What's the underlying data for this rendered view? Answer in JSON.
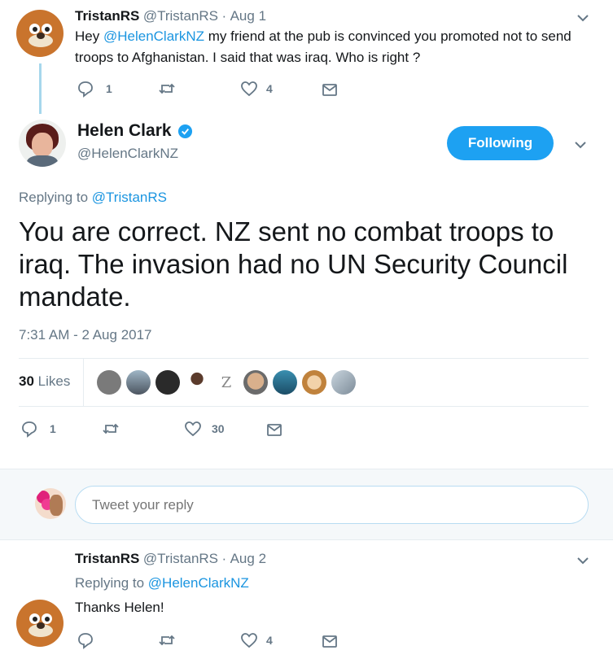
{
  "tweet1": {
    "author_name": "TristanRS",
    "author_handle": "@TristanRS",
    "separator": "·",
    "date": "Aug 1",
    "text_before": "Hey ",
    "mention": "@HelenClarkNZ",
    "text_after": " my friend at the pub is convinced you promoted not to send troops to Afghanistan. I said that was iraq. Who is right ?",
    "reply_count": "1",
    "retweet_count": "",
    "like_count": "4",
    "avatar_icon": "muppet-avatar-icon"
  },
  "main_tweet": {
    "author_name": "Helen Clark",
    "author_handle": "@HelenClarkNZ",
    "verified_icon": "verified-badge-icon",
    "follow_button_label": "Following",
    "replying_to_label": "Replying to ",
    "replying_to_handle": "@TristanRS",
    "text": "You are correct. NZ sent no combat troops to iraq. The invasion had no UN Security Council mandate.",
    "timestamp": "7:31 AM - 2 Aug 2017",
    "likes_count": "30",
    "likes_label": "Likes",
    "reply_count": "1",
    "retweet_count": "",
    "like_count": "30",
    "liker_avatar_count": 9,
    "liker_letter": "Z"
  },
  "reply_box": {
    "placeholder": "Tweet your reply"
  },
  "tweet3": {
    "author_name": "TristanRS",
    "author_handle": "@TristanRS",
    "separator": "·",
    "date": "Aug 2",
    "replying_to_label": "Replying to ",
    "replying_to_handle": "@HelenClarkNZ",
    "text": "Thanks Helen!",
    "reply_count": "",
    "retweet_count": "",
    "like_count": "4"
  },
  "colors": {
    "accent": "#1b95e0",
    "follow_button": "#1da1f2",
    "text_secondary": "#657786",
    "divider": "#e6ecf0",
    "reply_area_bg": "#f5f8fa",
    "thread_line": "#a6d7ec"
  }
}
